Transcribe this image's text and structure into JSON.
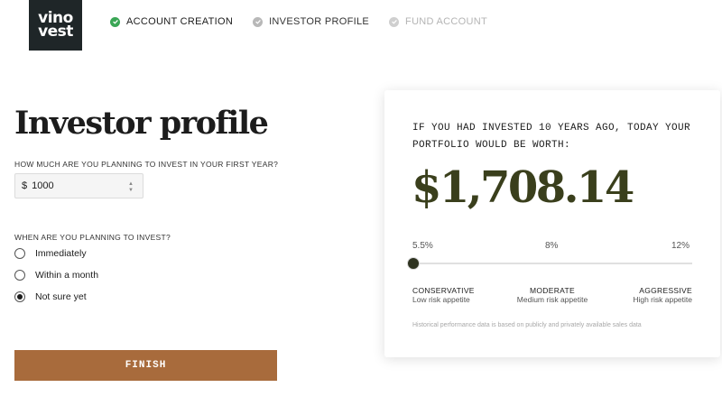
{
  "logo": {
    "line1": "vino",
    "line2": "vest"
  },
  "steps": [
    {
      "label": "ACCOUNT CREATION",
      "state": "done"
    },
    {
      "label": "INVESTOR PROFILE",
      "state": "active"
    },
    {
      "label": "FUND ACCOUNT",
      "state": "pending"
    }
  ],
  "form": {
    "title": "Investor profile",
    "amount_question": "HOW MUCH ARE YOU PLANNING TO INVEST IN YOUR FIRST YEAR?",
    "currency": "$",
    "amount_value": "1000",
    "timing_question": "WHEN ARE YOU PLANNING TO INVEST?",
    "options": [
      {
        "label": "Immediately",
        "selected": false
      },
      {
        "label": "Within a month",
        "selected": false
      },
      {
        "label": "Not sure yet",
        "selected": true
      }
    ],
    "finish_label": "FINISH"
  },
  "projection": {
    "question": "IF YOU HAD INVESTED 10 YEARS AGO, TODAY YOUR PORTFOLIO WOULD BE WORTH:",
    "value": "$1,708.14",
    "ticks": [
      "5.5%",
      "8%",
      "12%"
    ],
    "slider_value_fraction": 0.0,
    "risks": [
      {
        "title": "CONSERVATIVE",
        "subtitle": "Low risk appetite"
      },
      {
        "title": "MODERATE",
        "subtitle": "Medium risk appetite"
      },
      {
        "title": "AGGRESSIVE",
        "subtitle": "High risk appetite"
      }
    ],
    "disclaimer": "Historical performance data is based on publicly and privately available sales data"
  },
  "colors": {
    "accent_button": "#a86b3c",
    "value_text": "#3a3f1c",
    "check_green": "#3aa655",
    "logo_bg": "#1f2628"
  }
}
